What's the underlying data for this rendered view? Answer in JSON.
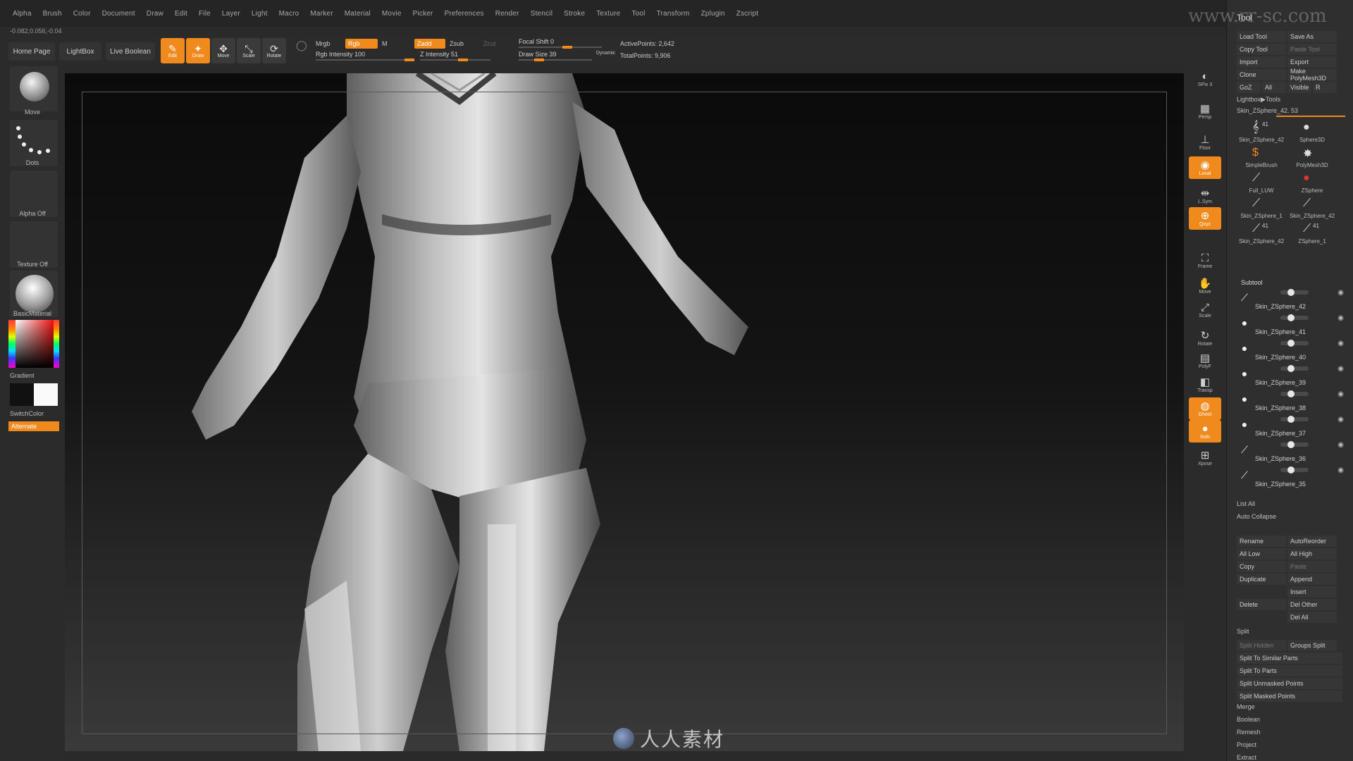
{
  "menu": [
    "Alpha",
    "Brush",
    "Color",
    "Document",
    "Draw",
    "Edit",
    "File",
    "Layer",
    "Light",
    "Macro",
    "Marker",
    "Material",
    "Movie",
    "Picker",
    "Preferences",
    "Render",
    "Stencil",
    "Stroke",
    "Texture",
    "Tool",
    "Transform",
    "Zplugin",
    "Zscript"
  ],
  "coords": "-0.082,0.056,-0.04",
  "nav": {
    "home": "Home Page",
    "lightbox": "LightBox",
    "live_boolean": "Live Boolean"
  },
  "modes": [
    {
      "label": "Edit",
      "glyph": "✎",
      "active": true
    },
    {
      "label": "Draw",
      "glyph": "✦",
      "active": true
    },
    {
      "label": "Move",
      "glyph": "✥",
      "active": false
    },
    {
      "label": "Scale",
      "glyph": "⤡",
      "active": false
    },
    {
      "label": "Rotate",
      "glyph": "⟳",
      "active": false
    }
  ],
  "color_opts": {
    "mrgb": "Mrgb",
    "rgb": "Rgb",
    "m": "M",
    "rgb_intensity": "Rgb Intensity 100"
  },
  "z_opts": {
    "zadd": "Zadd",
    "zsub": "Zsub",
    "zcut": "Zcut",
    "z_intensity": "Z Intensity 51"
  },
  "focal": {
    "focal_shift": "Focal Shift 0",
    "draw_size": "Draw Size 39",
    "dynamic": "Dynamic"
  },
  "points": {
    "active": "ActivePoints: 2,642",
    "total": "TotalPoints: 9,906"
  },
  "left_tray": {
    "brush": "Move",
    "stroke": "Dots",
    "alpha": "Alpha Off",
    "texture": "Texture Off",
    "material": "BasicMaterial",
    "gradient": "Gradient",
    "switch_color": "SwitchColor",
    "alternate": "Alternate"
  },
  "right_col": [
    {
      "label": "SPix 3",
      "glyph": "◐",
      "active": false
    },
    {
      "label": "Persp",
      "glyph": "▦",
      "active": false
    },
    {
      "label": "Floor",
      "glyph": "⊥",
      "active": false
    },
    {
      "label": "Local",
      "glyph": "◉",
      "active": true
    },
    {
      "label": "L.Sym",
      "glyph": "⇹",
      "active": false
    },
    {
      "label": "Qxyz",
      "glyph": "⊕",
      "active": true
    },
    {
      "label": "Frame",
      "glyph": "⛶",
      "active": false
    },
    {
      "label": "Move",
      "glyph": "✋",
      "active": false
    },
    {
      "label": "Scale",
      "glyph": "⤢",
      "active": false
    },
    {
      "label": "Rotate",
      "glyph": "↻",
      "active": false
    },
    {
      "label": "PolyF",
      "glyph": "▤",
      "active": false
    },
    {
      "label": "Transp",
      "glyph": "◧",
      "active": false
    },
    {
      "label": "Ghost",
      "glyph": "◍",
      "active": true
    },
    {
      "label": "Solo",
      "glyph": "●",
      "active": true
    },
    {
      "label": "Xpose",
      "glyph": "⊞",
      "active": false
    }
  ],
  "tool": {
    "title": "Tool",
    "buttons": [
      [
        "Load Tool",
        "Save As"
      ],
      [
        "Copy Tool",
        "Paste Tool"
      ],
      [
        "Import",
        "Export"
      ],
      [
        "Clone",
        "Make PolyMesh3D"
      ],
      [
        "GoZ",
        "All",
        "Visible",
        "R"
      ]
    ],
    "lightbox_tools": "Lightbox▶Tools",
    "current": "Skin_ZSphere_42. 53",
    "thumbs": [
      "Skin_ZSphere_42",
      "Sphere3D",
      "SimpleBrush",
      "PolyMesh3D",
      "Full_LUW",
      "ZSphere",
      "Skin_ZSphere_1",
      "Skin_ZSphere_42",
      "Skin_ZSphere_42",
      "ZSphere_1"
    ],
    "thumb_badges": [
      "41",
      "41",
      "41"
    ],
    "subtool_header": "Subtool",
    "subtools": [
      "Skin_ZSphere_42",
      "Skin_ZSphere_41",
      "Skin_ZSphere_40",
      "Skin_ZSphere_39",
      "Skin_ZSphere_38",
      "Skin_ZSphere_37",
      "Skin_ZSphere_36",
      "Skin_ZSphere_35"
    ],
    "list_all": "List All",
    "auto_collapse": "Auto Collapse",
    "actions": [
      [
        "Rename",
        "AutoReorder"
      ],
      [
        "All Low",
        "All High"
      ],
      [
        "Copy",
        "Paste"
      ],
      [
        "Duplicate",
        "Append"
      ],
      [
        "",
        "Insert"
      ],
      [
        "Delete",
        "Del Other"
      ],
      [
        "",
        "Del All"
      ]
    ],
    "split_header": "Split",
    "split": [
      [
        "Split Hidden",
        "Groups Split"
      ],
      [
        "Split To Similar Parts",
        ""
      ],
      [
        "Split To Parts",
        ""
      ],
      [
        "Split Unmasked Points",
        ""
      ],
      [
        "Split Masked Points",
        ""
      ]
    ],
    "more": [
      "Merge",
      "Boolean",
      "Remesh",
      "Project",
      "Extract"
    ]
  },
  "watermark": {
    "brand": "人人素材",
    "site": "www.rr-sc.com"
  },
  "colors": {
    "accent": "#f08a1c",
    "panel": "#2f2f2f",
    "bg": "#2a2a2a"
  }
}
